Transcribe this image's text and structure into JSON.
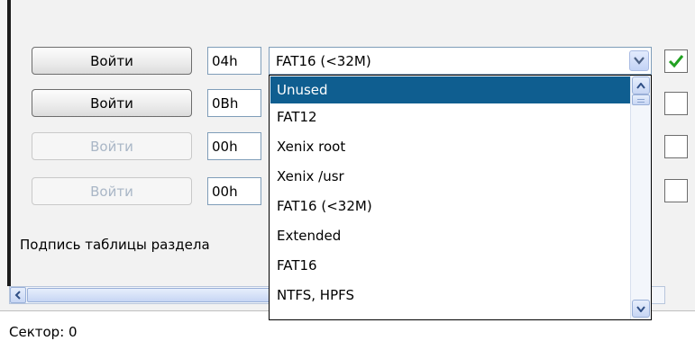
{
  "partition_rows": [
    {
      "button_label": "Войти",
      "hex": "04h",
      "enabled": true,
      "checked": true
    },
    {
      "button_label": "Войти",
      "hex": "0Bh",
      "enabled": true,
      "checked": false
    },
    {
      "button_label": "Войти",
      "hex": "00h",
      "enabled": false,
      "checked": false
    },
    {
      "button_label": "Войти",
      "hex": "00h",
      "enabled": false,
      "checked": false
    }
  ],
  "combo": {
    "value": "FAT16 (<32M)",
    "options": [
      "Unused",
      "FAT12",
      "Xenix root",
      "Xenix /usr",
      "FAT16 (<32M)",
      "Extended",
      "FAT16",
      "NTFS, HPFS"
    ],
    "highlighted_index": 0
  },
  "caption": "Подпись таблицы раздела",
  "status": "Сектор: 0",
  "icons": {
    "combo_arrow": "chevron-down-icon",
    "checkbox_check": "checkmark-icon",
    "scroll_left": "arrow-left-icon",
    "scroll_up": "chevron-up-icon",
    "scroll_down": "chevron-down-icon"
  },
  "colors": {
    "selection": "#0f5e90",
    "checkmark": "#21a121",
    "disabled_text": "#a9b6c6"
  }
}
